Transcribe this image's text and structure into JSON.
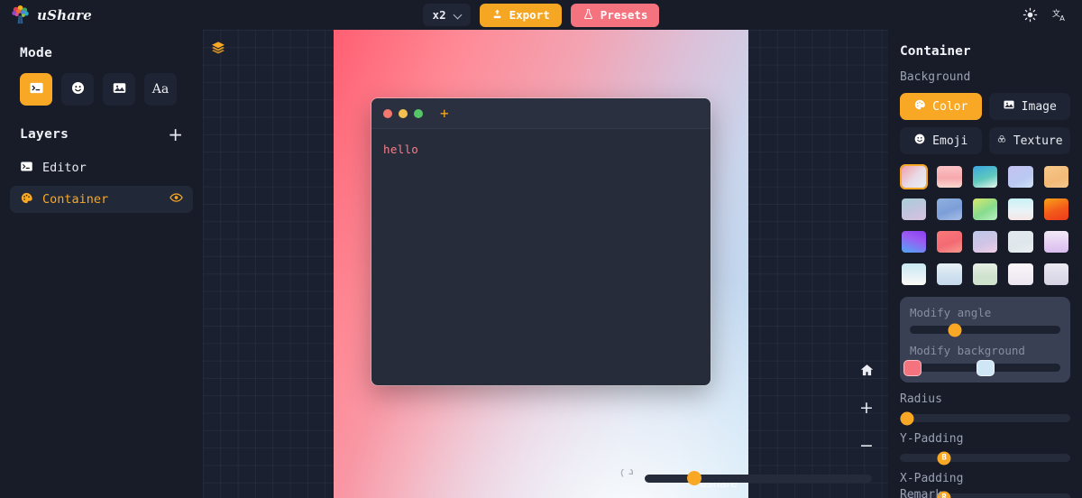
{
  "header": {
    "brand_name": "uShare",
    "logo_icon": "tree-avatar-logo",
    "zoom_value": "x2",
    "zoom_chevron_icon": "chevron-down-icon",
    "export_label": "Export",
    "export_icon": "upload-icon",
    "export_color": "#f5a623",
    "presets_label": "Presets",
    "presets_icon": "flask-icon",
    "presets_color": "#f4737f",
    "theme_icon": "sun-icon",
    "language_icon": "translate-icon"
  },
  "sidebar": {
    "mode_title": "Mode",
    "modes": [
      {
        "name": "terminal",
        "icon": "terminal-icon",
        "active": true
      },
      {
        "name": "emoji",
        "icon": "smiley-icon",
        "active": false
      },
      {
        "name": "image",
        "icon": "image-icon",
        "active": false
      },
      {
        "name": "text",
        "icon": "text-aa-icon",
        "label": "Aa",
        "active": false
      }
    ],
    "layers_title": "Layers",
    "add_layer_icon": "plus-icon",
    "layers": [
      {
        "label": "Editor",
        "icon": "terminal-icon",
        "selected": false,
        "visible": false
      },
      {
        "label": "Container",
        "icon": "palette-icon",
        "selected": true,
        "visible": true,
        "eye_icon": "eye-icon"
      }
    ],
    "accent_color": "#f9a825"
  },
  "canvas": {
    "layers_icon": "layers-stack-icon",
    "watermark": "ushare",
    "code_window": {
      "dots": [
        "#f4786e",
        "#f2c14e",
        "#55c667"
      ],
      "add_tab_icon": "plus-icon",
      "code_text": "hello",
      "code_color": "#f0808c"
    },
    "controls": {
      "home_icon": "home-icon",
      "zoom_in_label": "+",
      "zoom_out_label": "−",
      "reset_icon": "refresh-icon",
      "zoom_slider_percent": 22
    },
    "gradient": {
      "from": "#ff5f72",
      "to": "#b8dcf4"
    }
  },
  "panel": {
    "tune_icon": "sliders-icon",
    "title": "Container",
    "background_label": "Background",
    "tabs": [
      {
        "label": "Color",
        "icon": "palette-icon",
        "active": true
      },
      {
        "label": "Image",
        "icon": "image-icon",
        "active": false
      },
      {
        "label": "Emoji",
        "icon": "smiley-icon",
        "active": false
      },
      {
        "label": "Texture",
        "icon": "texture-icon",
        "active": false
      }
    ],
    "swatches": [
      {
        "css": "linear-gradient(135deg,#f2a0a8 0%,#e8dce8 55%,#e9eef2 100%)",
        "selected": true
      },
      {
        "css": "linear-gradient(180deg,#fbc3c6 0%,#f7a8ad 55%,#f8d9d2 100%)",
        "selected": false
      },
      {
        "css": "linear-gradient(160deg,#3aa6e0 0%,#5fc9bd 55%,#e9f7ee 100%)",
        "selected": false
      },
      {
        "css": "linear-gradient(150deg,#c5c2f0 0%,#b9c9f2 60%,#cfe2f7 100%)",
        "selected": false
      },
      {
        "css": "linear-gradient(160deg,#f6c98b 0%,#f3b977 60%,#f5c98e 100%)",
        "selected": false
      },
      {
        "css": "linear-gradient(160deg,#a8cfd8 0%,#c4c3dd 55%,#d8c3df 100%)",
        "selected": false
      },
      {
        "css": "linear-gradient(160deg,#8fb0e0 0%,#7c9ed8 55%,#a9bfe6 100%)",
        "selected": false
      },
      {
        "css": "linear-gradient(150deg,#d8e86a 0%,#86dc8e 55%,#b9f0c2 100%)",
        "selected": false
      },
      {
        "css": "linear-gradient(180deg,#c8f2f5 0%,#e9f2f6 55%,#f5e7e4 100%)",
        "selected": false
      },
      {
        "css": "linear-gradient(160deg,#f9a318 0%,#f2591a 55%,#ef3b1c 100%)",
        "selected": false
      },
      {
        "css": "linear-gradient(200deg,#8b3ef0 0%,#9a5cf2 40%,#4fa8f5 100%)",
        "selected": false
      },
      {
        "css": "linear-gradient(160deg,#f97a7a 0%,#f36a74 55%,#f79a8e 100%)",
        "selected": false
      },
      {
        "css": "linear-gradient(160deg,#bcc8e8 0%,#d0c4e6 55%,#f0cfe6 100%)",
        "selected": false
      },
      {
        "css": "linear-gradient(160deg,#e3eaef 0%,#dfe7ec 55%,#e9eef1 100%)",
        "selected": false
      },
      {
        "css": "linear-gradient(180deg,#f3eaf8 0%,#e4cdf2 60%,#dabdee 100%)",
        "selected": false
      },
      {
        "css": "linear-gradient(180deg,#c9e9f2 0%,#e4f1f6 55%,#fcfbf6 100%)",
        "selected": false
      },
      {
        "css": "linear-gradient(180deg,#e9f1f7 0%,#cfe0ef 60%,#c6daec 100%)",
        "selected": false
      },
      {
        "css": "linear-gradient(180deg,#e7efe6 0%,#cfe2cd 60%,#cfe3cc 100%)",
        "selected": false
      },
      {
        "css": "linear-gradient(180deg,#faf6f8 0%,#f1ecf3 60%,#ebe6f0 100%)",
        "selected": false
      },
      {
        "css": "linear-gradient(180deg,#eceaf2 0%,#dddbe9 60%,#d6d4e4 100%)",
        "selected": false
      }
    ],
    "modify": {
      "angle_label": "Modify angle",
      "angle_percent": 30,
      "background_label": "Modify background",
      "bg_stop1_percent": 2,
      "bg_stop1_color": "#f4737f",
      "bg_stop2_percent": 50,
      "bg_stop2_color": "#cfe6f7"
    },
    "controls": [
      {
        "label": "Radius",
        "percent": 4,
        "thumb_text": ""
      },
      {
        "label": "Y-Padding",
        "percent": 26,
        "thumb_text": "B"
      },
      {
        "label": "X-Padding",
        "percent": 26,
        "thumb_text": "R"
      }
    ],
    "cut_label": "Remark"
  }
}
